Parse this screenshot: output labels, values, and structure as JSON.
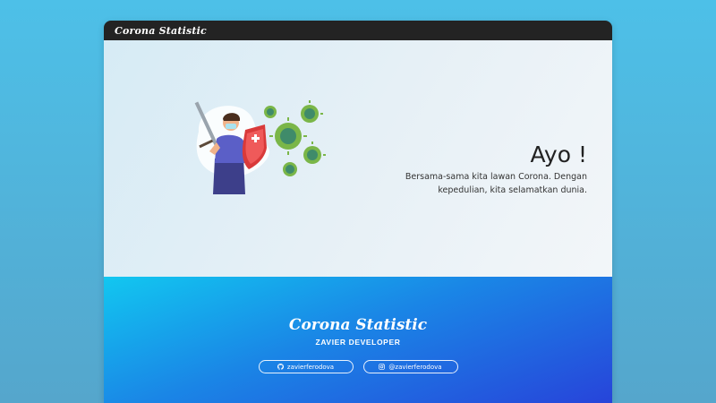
{
  "navbar": {
    "brand": "Corona Statistic"
  },
  "hero": {
    "title": "Ayo !",
    "text": "Bersama-sama kita lawan Corona. Dengan kepedulian, kita selamatkan dunia."
  },
  "footer": {
    "brand": "Corona Statistic",
    "developer": "ZAVIER DEVELOPER",
    "links": [
      {
        "label": "zavierferodova",
        "icon": "github-icon"
      },
      {
        "label": "@zavierferodova",
        "icon": "instagram-icon"
      }
    ]
  }
}
